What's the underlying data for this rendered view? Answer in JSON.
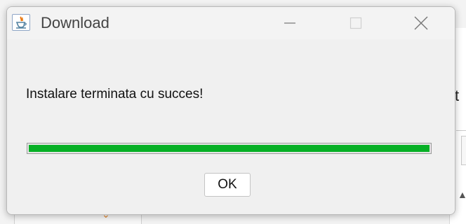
{
  "window": {
    "title": "Download",
    "app_icon": "java-icon"
  },
  "dialog": {
    "message": "Instalare terminata cu succes!",
    "progress_percent": 100,
    "progress_color": "#06b025",
    "ok_label": "OK"
  },
  "background": {
    "right_fragment_text": "t"
  }
}
